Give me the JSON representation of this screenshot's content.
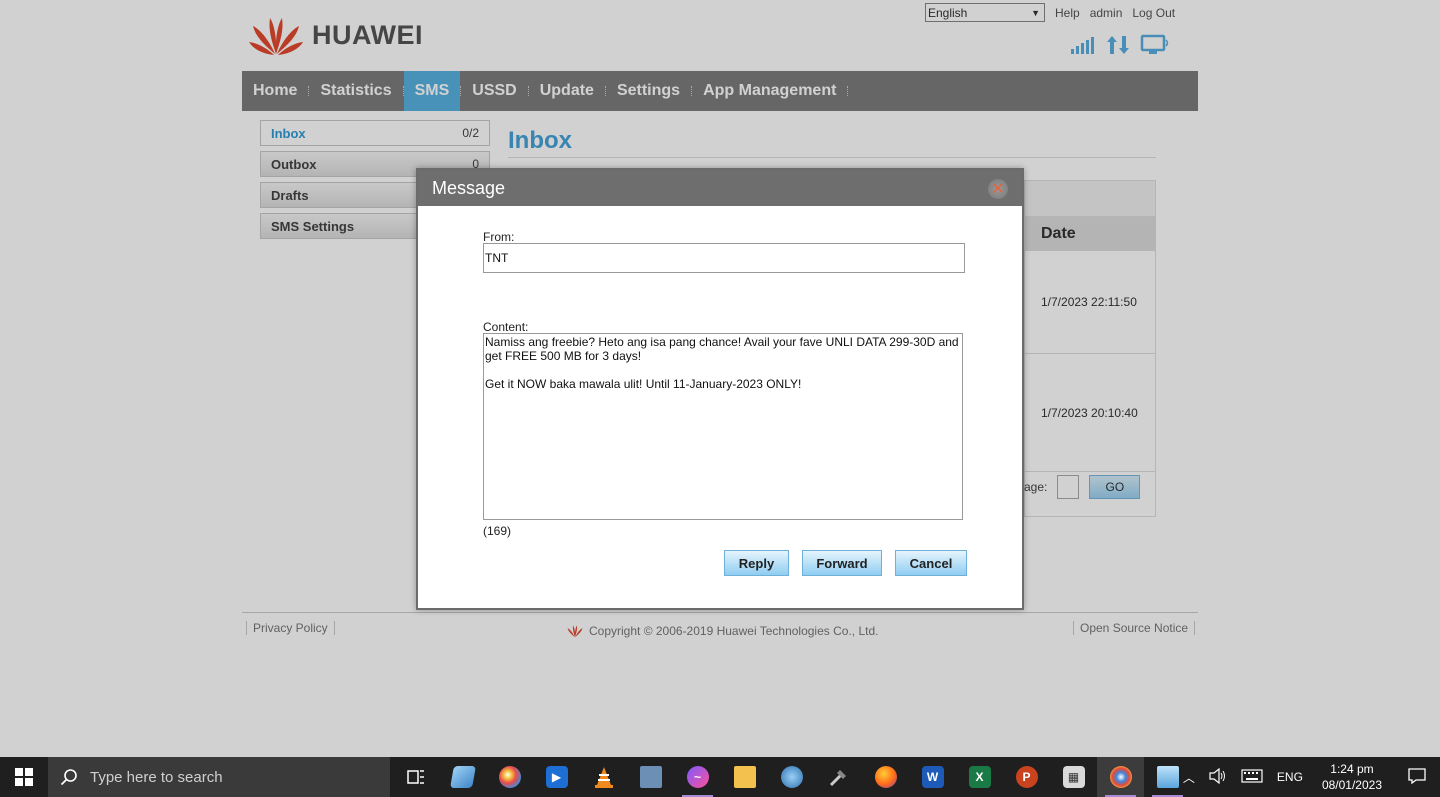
{
  "header": {
    "brand": "HUAWEI",
    "language": "English",
    "links": [
      "Help",
      "admin",
      "Log Out"
    ]
  },
  "nav": {
    "items": [
      "Home",
      "Statistics",
      "SMS",
      "USSD",
      "Update",
      "Settings",
      "App Management"
    ],
    "active": "SMS"
  },
  "sidebar": {
    "items": [
      {
        "label": "Inbox",
        "count": "0/2"
      },
      {
        "label": "Outbox",
        "count": "0"
      },
      {
        "label": "Drafts",
        "count": ""
      },
      {
        "label": "SMS Settings",
        "count": ""
      }
    ]
  },
  "main": {
    "title": "Inbox",
    "table": {
      "date_header": "Date",
      "dates": [
        "1/7/2023 22:11:50",
        "1/7/2023 20:10:40"
      ]
    },
    "pager": {
      "label": "age:",
      "go_label": "GO"
    }
  },
  "dialog": {
    "title": "Message",
    "from_label": "From:",
    "from_value": "TNT",
    "content_label": "Content:",
    "content_value": "Namiss ang freebie? Heto ang isa pang chance! Avail your fave UNLI DATA 299-30D and get FREE 500 MB for 3 days!\n\nGet it NOW baka mawala ulit! Until 11-January-2023 ONLY!",
    "char_count": "(169)",
    "reply_label": "Reply",
    "forward_label": "Forward",
    "cancel_label": "Cancel"
  },
  "footer": {
    "privacy": "Privacy Policy",
    "copyright": "Copyright © 2006-2019 Huawei Technologies Co., Ltd.",
    "open_source": "Open Source Notice"
  },
  "taskbar": {
    "search_placeholder": "Type here to search",
    "language": "ENG",
    "time": "1:24 pm",
    "date": "08/01/2023"
  },
  "colors": {
    "nav_active": "#58b2e3",
    "nav_bg": "#7d7d7d",
    "accent_blue": "#46a3da",
    "button_blue": "#8fcdf1",
    "logo_red": "#e3482f"
  }
}
